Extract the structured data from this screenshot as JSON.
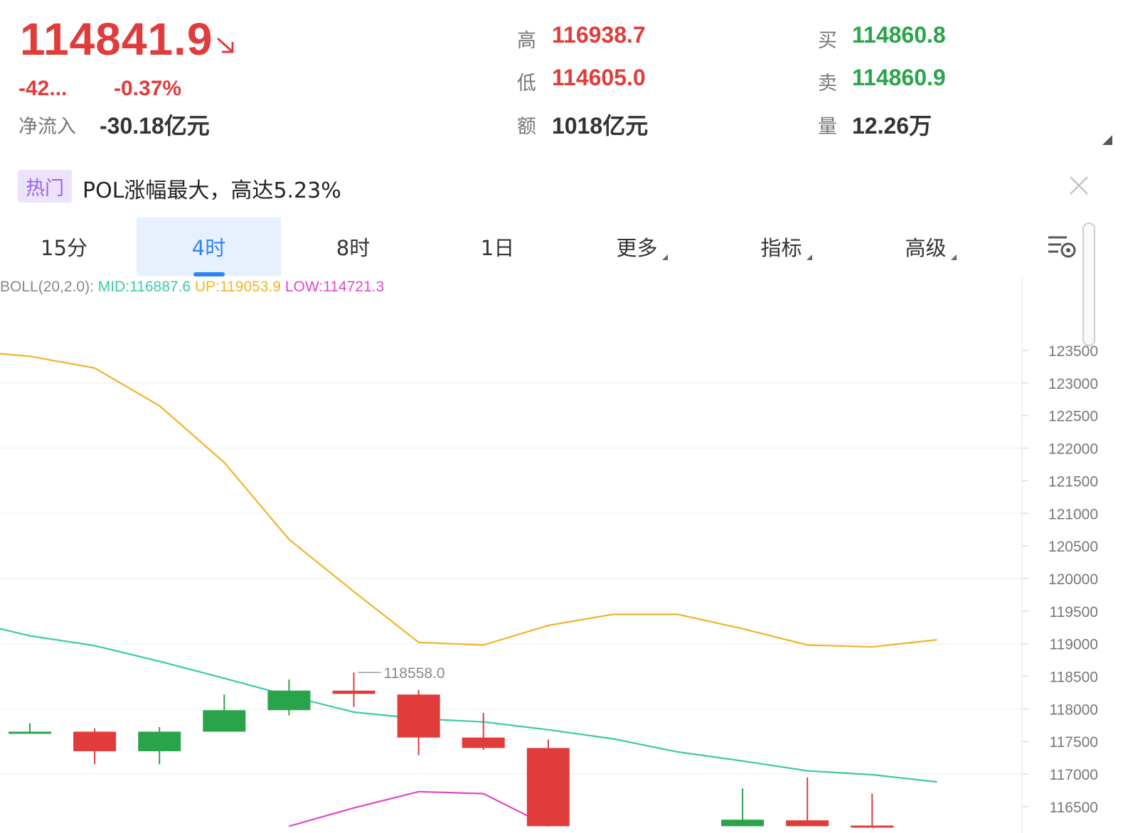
{
  "ticker": {
    "price": "114841.9",
    "change": "-42...",
    "change_pct": "-0.37%",
    "net_inflow_label": "净流入",
    "net_inflow_value": "-30.18亿元",
    "high_label": "高",
    "high_value": "116938.7",
    "low_label": "低",
    "low_value": "114605.0",
    "amount_label": "额",
    "amount_value": "1018亿元",
    "buy_label": "买",
    "buy_value": "114860.8",
    "sell_label": "卖",
    "sell_value": "114860.9",
    "volume_label": "量",
    "volume_value": "12.26万",
    "colors": {
      "up": "#e03c3c",
      "down": "#2aa44a"
    }
  },
  "hot_banner": {
    "badge": "热门",
    "text": "POL涨幅最大，高达5.23%"
  },
  "tabs": [
    {
      "label": "15分",
      "active": false
    },
    {
      "label": "4时",
      "active": true
    },
    {
      "label": "8时",
      "active": false
    },
    {
      "label": "1日",
      "active": false
    },
    {
      "label": "更多",
      "active": false,
      "dropdown": true
    },
    {
      "label": "指标",
      "active": false,
      "dropdown": true
    },
    {
      "label": "高级",
      "active": false,
      "dropdown": true
    }
  ],
  "indicator": {
    "name": "BOLL(20,2.0):",
    "mid": "MID:116887.6",
    "up": "UP:119053.9",
    "low": "LOW:114721.3",
    "colors": {
      "mid": "#3cc9a6",
      "up": "#f0b429",
      "low": "#e048c8"
    }
  },
  "chart_data": {
    "type": "candlestick",
    "y_ticks": [
      "123500",
      "123000",
      "122500",
      "122000",
      "121500",
      "121000",
      "120500",
      "120000",
      "119500",
      "119000",
      "118500",
      "118000",
      "117500",
      "117000",
      "116500"
    ],
    "ylim": [
      116200,
      124000
    ],
    "max_marker": "118558.0",
    "candles": [
      {
        "open": 117650,
        "close": 117650,
        "high": 117780,
        "low": 117620
      },
      {
        "open": 117650,
        "close": 117350,
        "high": 117700,
        "low": 117150
      },
      {
        "open": 117350,
        "close": 117650,
        "high": 117720,
        "low": 117150
      },
      {
        "open": 117650,
        "close": 117980,
        "high": 118220,
        "low": 117650
      },
      {
        "open": 117980,
        "close": 118280,
        "high": 118450,
        "low": 117900
      },
      {
        "open": 118280,
        "close": 118230,
        "high": 118558,
        "low": 118030
      },
      {
        "open": 118220,
        "close": 117560,
        "high": 118290,
        "low": 117290
      },
      {
        "open": 117560,
        "close": 117400,
        "high": 117940,
        "low": 117370
      },
      {
        "open": 117400,
        "close": 116200,
        "high": 117530,
        "low": 116200
      },
      {
        "open": 116200,
        "close": 116200,
        "high": 116200,
        "low": 116200
      },
      {
        "open": 116200,
        "close": 116200,
        "high": 116200,
        "low": 116200
      },
      {
        "open": 116200,
        "close": 116300,
        "high": 116780,
        "low": 116200
      },
      {
        "open": 116290,
        "close": 116200,
        "high": 116950,
        "low": 116200
      },
      {
        "open": 116210,
        "close": 116200,
        "high": 116700,
        "low": 116200
      }
    ],
    "boll_up": [
      123450,
      123410,
      123230,
      122650,
      121780,
      120600,
      119800,
      119020,
      118980,
      119280,
      119450,
      119450,
      119230,
      118980,
      118950,
      119060
    ],
    "boll_mid": [
      119230,
      119120,
      118970,
      118730,
      118470,
      118200,
      117950,
      117850,
      117800,
      117680,
      117540,
      117340,
      117200,
      117050,
      116990,
      116880
    ],
    "boll_low": [
      null,
      null,
      null,
      null,
      null,
      116200,
      116480,
      116730,
      116700,
      116200
    ]
  }
}
